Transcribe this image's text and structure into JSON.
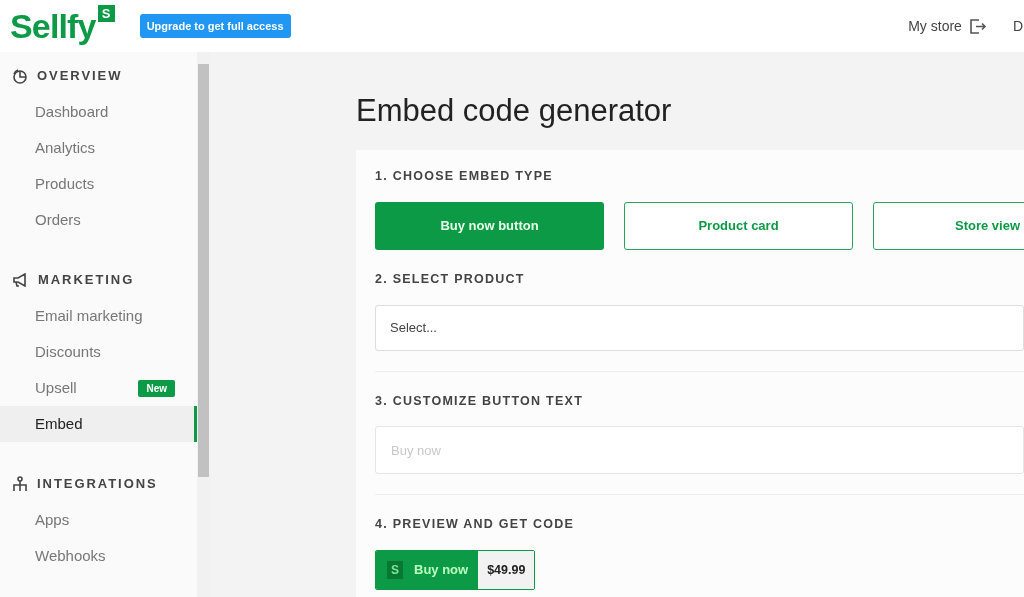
{
  "header": {
    "logo": "Sellfy",
    "logo_badge": "S",
    "upgrade": "Upgrade to get full access",
    "my_store": "My store",
    "cut_item": "D"
  },
  "sidebar": {
    "sections": [
      {
        "kind": "overview",
        "title": "OVERVIEW",
        "items": [
          {
            "label": "Dashboard",
            "selected": false
          },
          {
            "label": "Analytics",
            "selected": false
          },
          {
            "label": "Products",
            "selected": false
          },
          {
            "label": "Orders",
            "selected": false
          }
        ]
      },
      {
        "kind": "marketing",
        "title": "MARKETING",
        "items": [
          {
            "label": "Email marketing",
            "selected": false
          },
          {
            "label": "Discounts",
            "selected": false
          },
          {
            "label": "Upsell",
            "selected": false,
            "badge": "New"
          },
          {
            "label": "Embed",
            "selected": true
          }
        ]
      },
      {
        "kind": "integrations",
        "title": "INTEGRATIONS",
        "items": [
          {
            "label": "Apps",
            "selected": false
          },
          {
            "label": "Webhooks",
            "selected": false
          }
        ]
      }
    ]
  },
  "page_title": "Embed code generator",
  "steps": [
    {
      "kind": "types",
      "title": "1. CHOOSE EMBED TYPE",
      "options": [
        {
          "label": "Buy now button",
          "selected": true
        },
        {
          "label": "Product card",
          "selected": false
        },
        {
          "label": "Store view",
          "selected": false
        }
      ]
    },
    {
      "kind": "select",
      "title": "2. SELECT PRODUCT",
      "value": "Select..."
    },
    {
      "kind": "text",
      "title": "3. CUSTOMIZE BUTTON TEXT",
      "placeholder": "Buy now"
    },
    {
      "kind": "preview",
      "title": "4. PREVIEW AND GET CODE",
      "badge": "S",
      "label": "Buy now",
      "price": "$49.99"
    }
  ]
}
